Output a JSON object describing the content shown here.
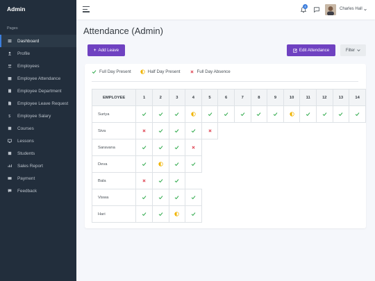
{
  "sidebar": {
    "brand": "Admin",
    "section_label": "Pages",
    "items": [
      {
        "label": "Dashboard",
        "icon": "sliders-icon",
        "active": true
      },
      {
        "label": "Profile",
        "icon": "user-icon"
      },
      {
        "label": "Employees",
        "icon": "users-icon"
      },
      {
        "label": "Employee Attendance",
        "icon": "calendar-icon"
      },
      {
        "label": "Employee Department",
        "icon": "building-icon"
      },
      {
        "label": "Employee Leave Request",
        "icon": "file-icon"
      },
      {
        "label": "Employee Salary",
        "icon": "dollar-icon"
      },
      {
        "label": "Courses",
        "icon": "book-icon"
      },
      {
        "label": "Lessons",
        "icon": "chalkboard-icon"
      },
      {
        "label": "Students",
        "icon": "student-icon"
      },
      {
        "label": "Sales Report",
        "icon": "chart-icon"
      },
      {
        "label": "Payment",
        "icon": "credit-card-icon"
      },
      {
        "label": "Feedback",
        "icon": "comment-icon"
      }
    ]
  },
  "topbar": {
    "notification_count": "4",
    "user_name": "Charles Hall"
  },
  "page": {
    "title": "Attendance (Admin)",
    "add_leave_label": "Add Leave",
    "edit_attendance_label": "Edit Attendance",
    "filter_label": "Filter"
  },
  "legend": {
    "full_day_present": "Full Day Present",
    "half_day_present": "Half Day Present",
    "full_day_absence": "Full Day Absence"
  },
  "colors": {
    "present": "#28a745",
    "half": "#f0b400",
    "absent": "#dc3545",
    "accent": "#6f42c1"
  },
  "table": {
    "employee_header": "EMPLOYEE",
    "days": [
      "1",
      "2",
      "3",
      "4",
      "5",
      "6",
      "7",
      "8",
      "9",
      "10",
      "11",
      "12",
      "13",
      "14"
    ],
    "rows": [
      {
        "name": "Suriya",
        "marks": [
          "P",
          "P",
          "P",
          "H",
          "P",
          "P",
          "P",
          "P",
          "P",
          "H",
          "P",
          "P",
          "P",
          "P"
        ]
      },
      {
        "name": "Siva",
        "marks": [
          "A",
          "P",
          "P",
          "P",
          "A"
        ]
      },
      {
        "name": "Saravana",
        "marks": [
          "P",
          "P",
          "P",
          "A"
        ]
      },
      {
        "name": "Deva",
        "marks": [
          "P",
          "H",
          "P",
          "P"
        ]
      },
      {
        "name": "Bala",
        "marks": [
          "A",
          "P",
          "P"
        ]
      },
      {
        "name": "Viswa",
        "marks": [
          "P",
          "P",
          "P",
          "P"
        ]
      },
      {
        "name": "Hari",
        "marks": [
          "P",
          "P",
          "H",
          "P"
        ]
      }
    ]
  }
}
